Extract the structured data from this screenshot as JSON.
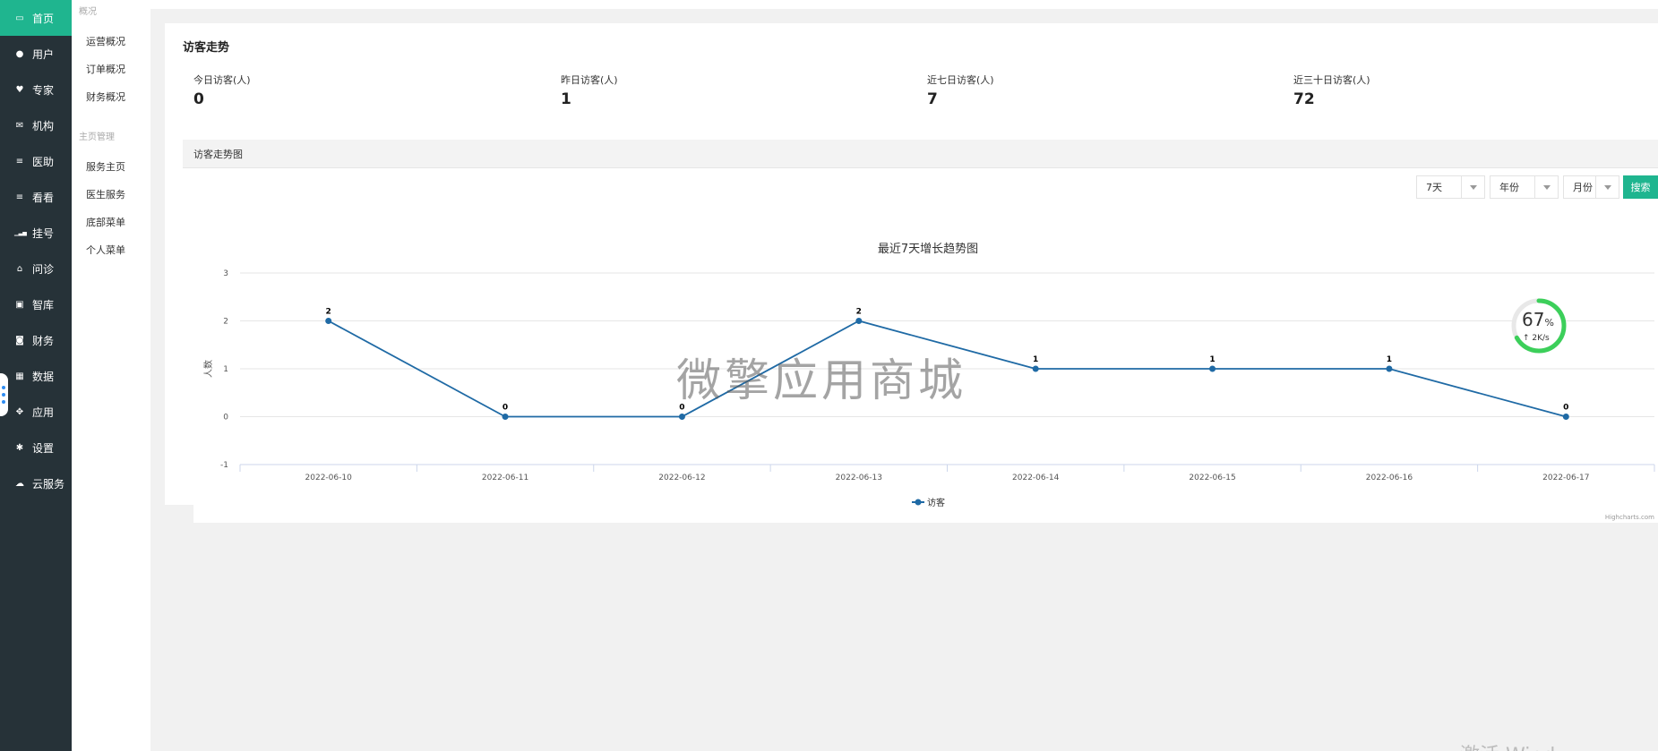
{
  "sidebar": {
    "items": [
      {
        "label": "首页",
        "icon": "monitor-icon",
        "active": true
      },
      {
        "label": "用户",
        "icon": "user-icon"
      },
      {
        "label": "专家",
        "icon": "heart-icon"
      },
      {
        "label": "机构",
        "icon": "mail-icon"
      },
      {
        "label": "医助",
        "icon": "list-icon"
      },
      {
        "label": "看看",
        "icon": "list-icon"
      },
      {
        "label": "挂号",
        "icon": "signal-icon"
      },
      {
        "label": "问诊",
        "icon": "home-icon"
      },
      {
        "label": "智库",
        "icon": "lock-icon"
      },
      {
        "label": "财务",
        "icon": "money-icon"
      },
      {
        "label": "数据",
        "icon": "grid-icon"
      },
      {
        "label": "应用",
        "icon": "cubes-icon"
      },
      {
        "label": "设置",
        "icon": "gear-icon"
      },
      {
        "label": "云服务",
        "icon": "cloud-icon"
      }
    ]
  },
  "submenu": {
    "group1_title": "概况",
    "group1_items": [
      "运营概况",
      "订单概况",
      "财务概况"
    ],
    "group2_title": "主页管理",
    "group2_items": [
      "服务主页",
      "医生服务",
      "底部菜单",
      "个人菜单"
    ]
  },
  "panel": {
    "title": "访客走势",
    "stats": [
      {
        "label": "今日访客(人)",
        "value": "0"
      },
      {
        "label": "昨日访客(人)",
        "value": "1"
      },
      {
        "label": "近七日访客(人)",
        "value": "7"
      },
      {
        "label": "近三十日访客(人)",
        "value": "72"
      }
    ],
    "section_title": "访客走势图"
  },
  "filters": {
    "range_value": "7天",
    "year_value": "年份",
    "month_value": "月份",
    "search_label": "搜索"
  },
  "chart_data": {
    "type": "line",
    "title": "最近7天增长趋势图",
    "ylabel": "人数",
    "ylim": [
      -1,
      3
    ],
    "yticks": [
      3,
      2,
      1,
      0,
      -1
    ],
    "categories": [
      "2022-06-10",
      "2022-06-11",
      "2022-06-12",
      "2022-06-13",
      "2022-06-14",
      "2022-06-15",
      "2022-06-16",
      "2022-06-17"
    ],
    "series": [
      {
        "name": "访客",
        "values": [
          2,
          0,
          0,
          2,
          1,
          1,
          1,
          0
        ]
      }
    ],
    "color": "#1f6aa5",
    "grid": true,
    "legend": "bottom-center",
    "credits": "Highcharts.com"
  },
  "overlay": {
    "watermark": "微擎应用商城",
    "gauge_value": "67",
    "gauge_unit": "%",
    "gauge_percent": 67,
    "speed": "↑ 2K/s",
    "windows_text": "激活 Wind"
  }
}
